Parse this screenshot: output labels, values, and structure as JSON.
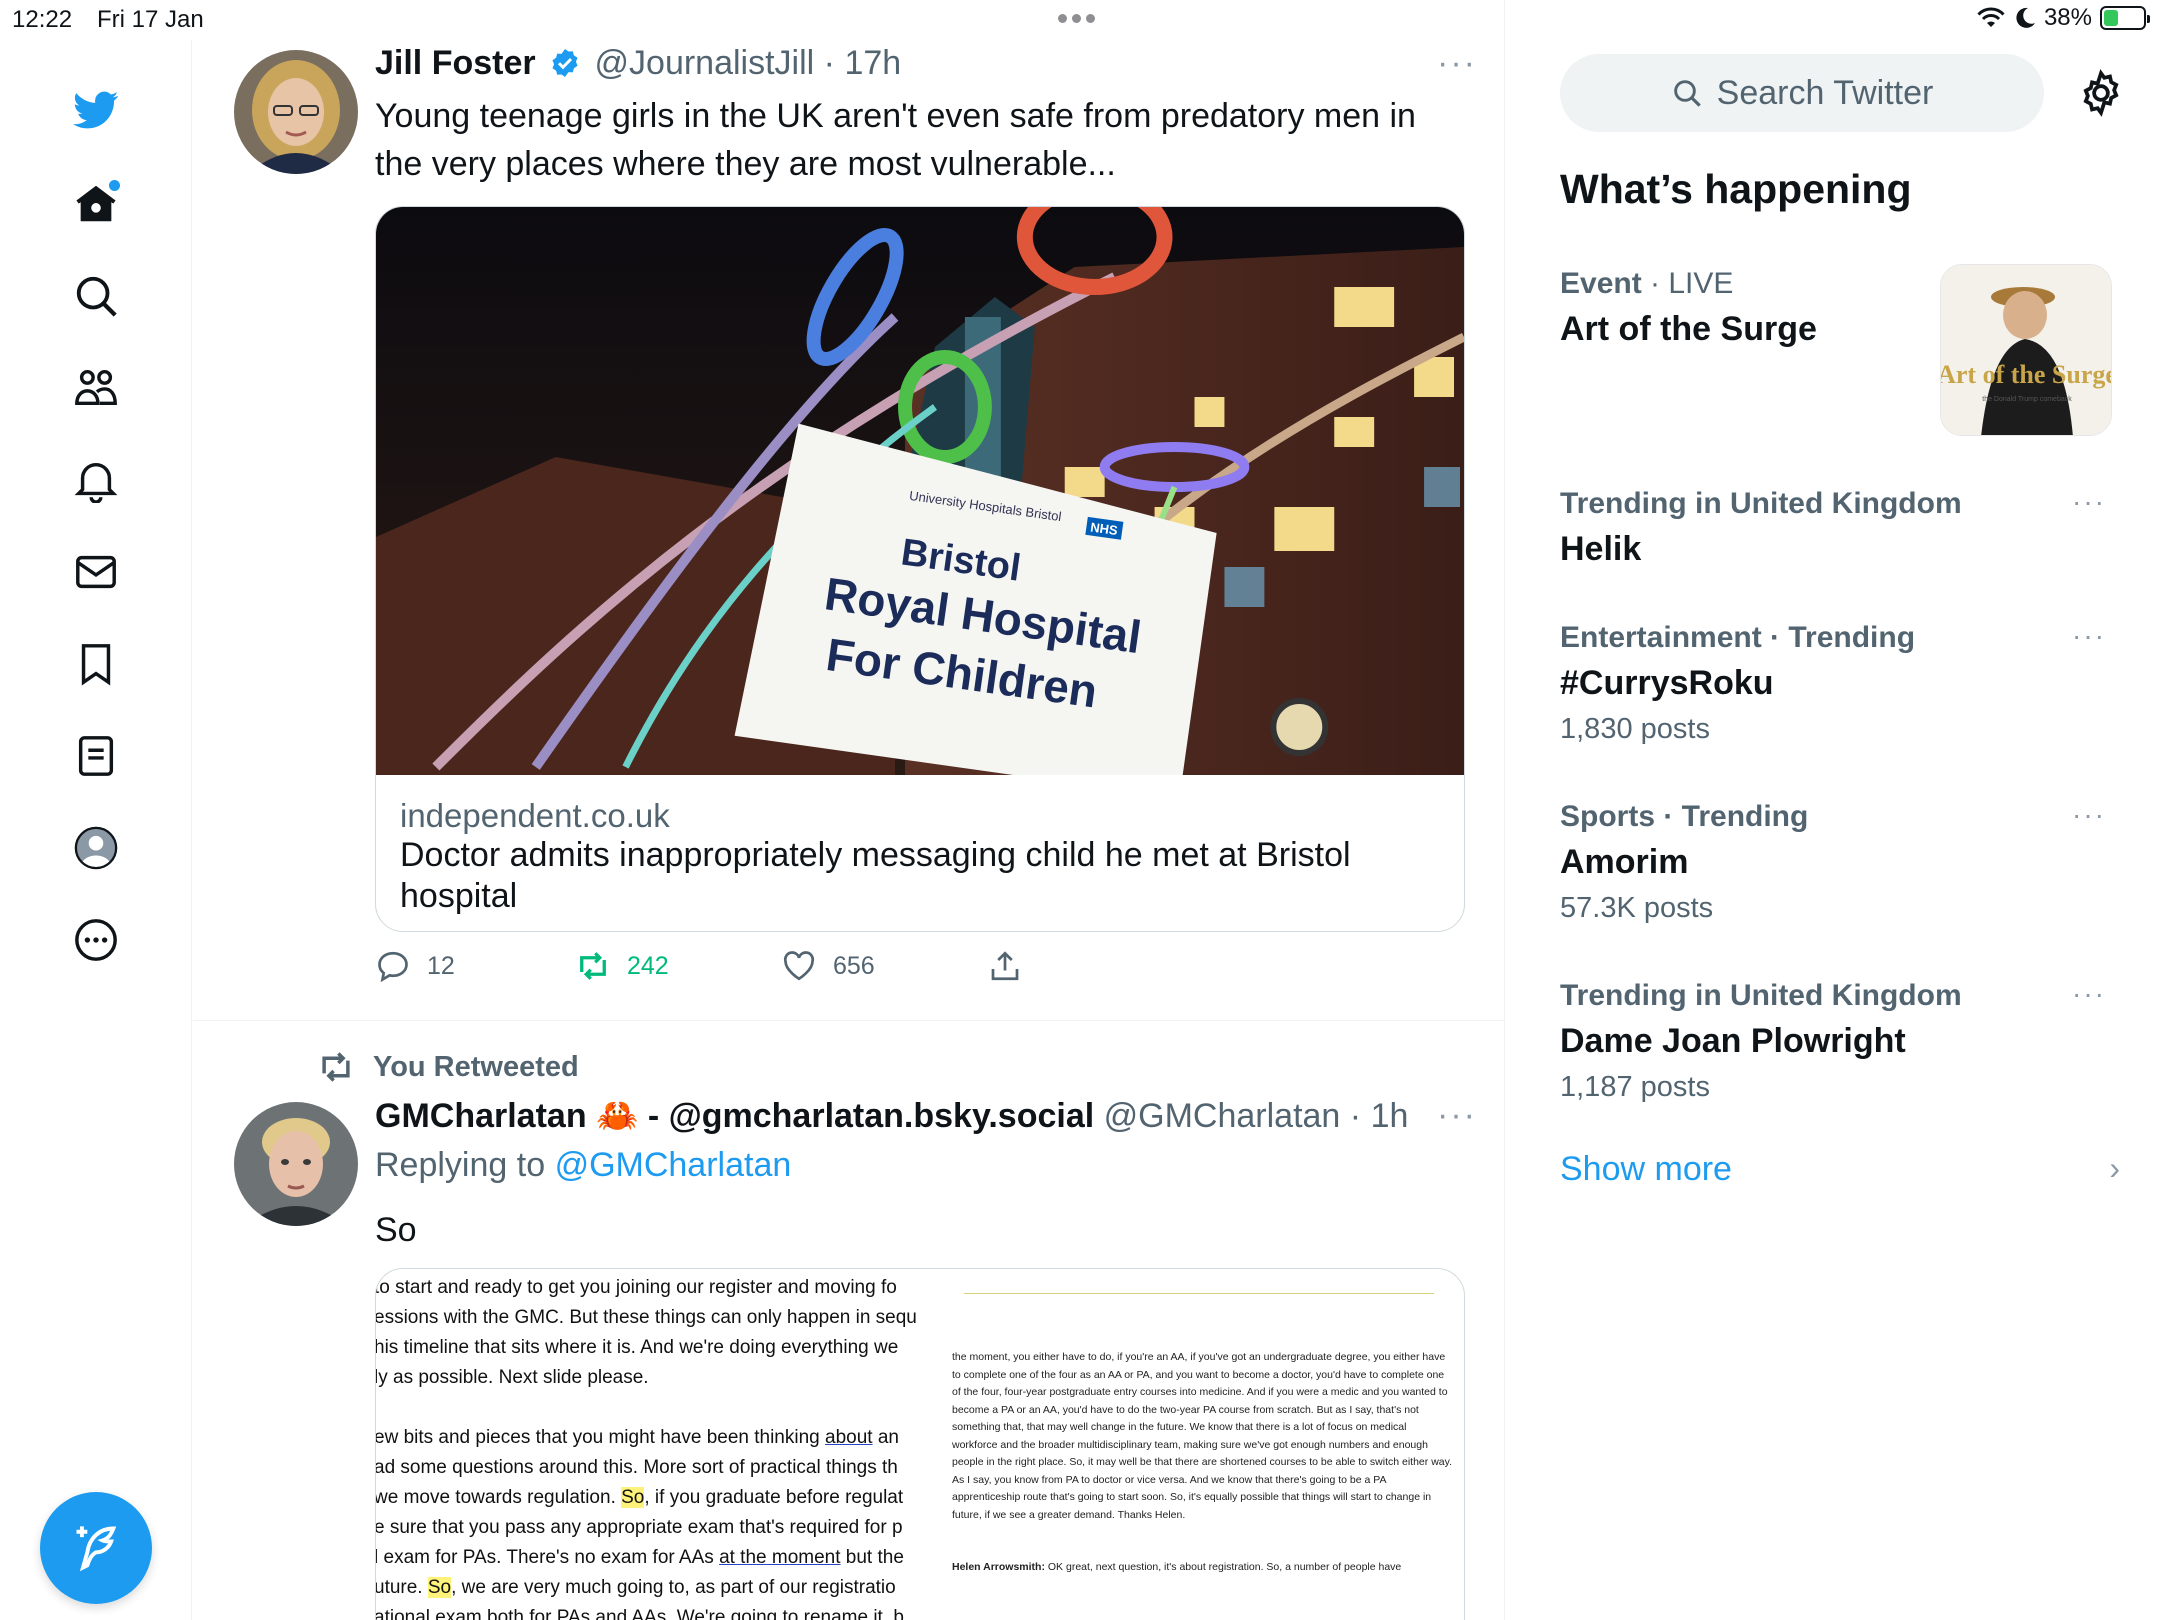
{
  "status_bar": {
    "time": "12:22",
    "date": "Fri 17 Jan",
    "battery": "38%",
    "battery_level": 0.38
  },
  "nav": {
    "items": [
      "twitter-logo",
      "home",
      "explore",
      "communities",
      "notifications",
      "messages",
      "bookmarks",
      "lists",
      "profile",
      "more"
    ],
    "compose_icon": "compose-icon"
  },
  "tweet1": {
    "name": "Jill Foster",
    "verified": true,
    "handle": "@JournalistJill",
    "time": "17h",
    "text": "Young teenage girls in the UK aren't even safe from predatory men in the very places where they are most vulnerable...",
    "card": {
      "domain": "independent.co.uk",
      "title": "Doctor admits inappropriately messaging child he met at Bristol hospital",
      "sign_small": "University Hospitals Bristol",
      "sign_nhs": "NHS",
      "sign_line1": "Bristol",
      "sign_line2": "Royal Hospital",
      "sign_line3": "For Children"
    },
    "replies": "12",
    "retweets": "242",
    "likes": "656"
  },
  "tweet2": {
    "retweet_label": "You Retweeted",
    "name": "GMCharlatan",
    "name_suffix": " - @gmcharlatan.bsky.social",
    "emoji": "🦀",
    "handle": "@GMCharlatan",
    "time": "1h",
    "replying_to_label": "Replying to",
    "replying_to": "@GMCharlatan",
    "text": "So",
    "doc_left_lines": [
      "to start and ready to get you joining our register and moving fo",
      "essions with the GMC. But these things can only happen in sequ",
      "his timeline that sits where it is. And we're doing everything we",
      "ly as possible. Next slide please.",
      "ew bits and pieces that you might have been thinking about an",
      "ad some questions around this. More sort of practical things th",
      "we move towards regulation. So, if you graduate before regulat",
      "e sure that you pass any appropriate exam that's required for p",
      "l exam for PAs. There's no exam for AAs at the moment but the",
      "uture. So, we are very much going to, as part of our registratio",
      "ational exam both for PAs and AAs. We're going to rename it, b"
    ],
    "doc_right_para": "the moment, you either have to do, if you're an AA, if you've got an undergraduate degree, you either have to complete one of the four as an AA or PA, and you want to become a doctor, you'd have to complete one of the four, four-year postgraduate entry courses into medicine. And if you were a medic and you wanted to become a PA or an AA, you'd have to do the two-year PA course from scratch. But as I say, that's not something that, that may well change in the future. We know that there is a lot of focus on medical workforce and the broader multidisciplinary team, making sure we've got enough numbers and enough people in the right place. So, it may well be that there are shortened courses to be able to switch either way. As I say, you know from PA to doctor or vice versa. And we know that there's going to be a PA apprenticeship route that's going to start soon. So, it's equally possible that things will start to change in future, if we see a greater demand. Thanks Helen.",
    "doc_right_speaker": "Helen Arrowsmith:",
    "doc_right_speaker_text": "OK great, next question, it's about registration. So, a number of people have"
  },
  "sidebar": {
    "search_placeholder": "Search Twitter",
    "title": "What’s happening",
    "event": {
      "context": "Event",
      "live": "LIVE",
      "name": "Art of the Surge",
      "thumb_text": "Art of the Surge",
      "thumb_sub": "the Donald Trump comeback"
    },
    "trends": [
      {
        "context": "Trending in United Kingdom",
        "name": "Helik",
        "count": ""
      },
      {
        "context": "Entertainment · Trending",
        "name": "#CurrysRoku",
        "count": "1,830 posts"
      },
      {
        "context": "Sports · Trending",
        "name": "Amorim",
        "count": "57.3K posts"
      },
      {
        "context": "Trending in United Kingdom",
        "name": "Dame Joan Plowright",
        "count": "1,187 posts"
      }
    ],
    "show_more": "Show more"
  }
}
